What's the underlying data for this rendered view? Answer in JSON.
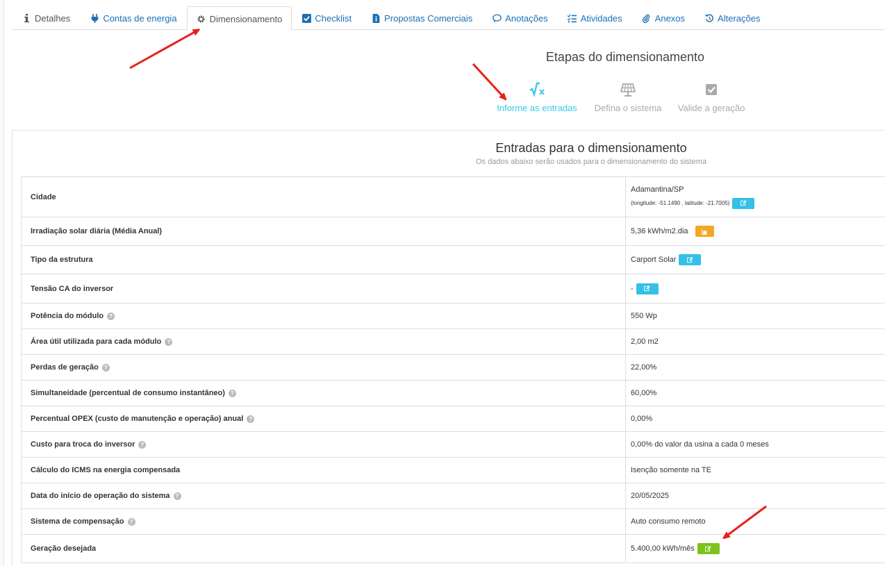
{
  "tabs": [
    {
      "label": "Detalhes",
      "icon": "info-icon",
      "active": false
    },
    {
      "label": "Contas de energia",
      "icon": "plug-icon",
      "active": false
    },
    {
      "label": "Dimensionamento",
      "icon": "gear-icon",
      "active": true
    },
    {
      "label": "Checklist",
      "icon": "checkbox-icon",
      "active": false
    },
    {
      "label": "Propostas Comerciais",
      "icon": "document-icon",
      "active": false
    },
    {
      "label": "Anotações",
      "icon": "comment-icon",
      "active": false
    },
    {
      "label": "Atividades",
      "icon": "list-check-icon",
      "active": false
    },
    {
      "label": "Anexos",
      "icon": "paperclip-icon",
      "active": false
    },
    {
      "label": "Alterações",
      "icon": "history-icon",
      "active": false
    }
  ],
  "steps": {
    "title": "Etapas do dimensionamento",
    "items": [
      {
        "label": "Informe as entradas",
        "icon": "sqrt-icon",
        "current": true
      },
      {
        "label": "Defina o sistema",
        "icon": "solar-panel-icon",
        "current": false
      },
      {
        "label": "Valide a geração",
        "icon": "check-square-icon",
        "current": false
      }
    ]
  },
  "inputs": {
    "title": "Entradas para o dimensionamento",
    "subtitle": "Os dados abaixo serão usados para o dimensionamento do sistema",
    "rows": [
      {
        "label": "Cidade",
        "value": "Adamantina/SP",
        "subvalue": "(longitude: -51.1490 , latitude: -21.7005)",
        "help": false
      },
      {
        "label": "Irradiação solar diária (Média Anual)",
        "value": "5,36 kWh/m2.dia",
        "help": false
      },
      {
        "label": "Tipo da estrutura",
        "value": "Carport Solar",
        "help": false
      },
      {
        "label": "Tensão CA do inversor",
        "value": "-",
        "help": false
      },
      {
        "label": "Potência do módulo",
        "value": "550 Wp",
        "help": true
      },
      {
        "label": "Área útil utilizada para cada módulo",
        "value": "2,00 m2",
        "help": true
      },
      {
        "label": "Perdas de geração",
        "value": "22,00%",
        "help": true
      },
      {
        "label": "Simultaneidade (percentual de consumo instantâneo)",
        "value": "60,00%",
        "help": true
      },
      {
        "label": "Percentual OPEX (custo de manutenção e operação) anual",
        "value": "0,00%",
        "help": true
      },
      {
        "label": "Custo para troca do inversor",
        "value": "0,00% do valor da usina a cada 0 meses",
        "help": true
      },
      {
        "label": "Cálculo do ICMS na energia compensada",
        "value": "Isenção somente na TE",
        "help": false
      },
      {
        "label": "Data do início de operação do sistema",
        "value": "20/05/2025",
        "help": true
      },
      {
        "label": "Sistema de compensação",
        "value": "Auto consumo remoto",
        "help": true
      },
      {
        "label": "Geração desejada",
        "value": "5.400,00 kWh/mês",
        "help": false
      }
    ]
  },
  "help_glyph": "?",
  "colors": {
    "link": "#1a6fb5",
    "info_button": "#35c0e8",
    "warn_button": "#f5a623",
    "ok_button": "#7bc41c",
    "step_active": "#3ec6e8",
    "annotation_arrow": "#e8201a"
  }
}
